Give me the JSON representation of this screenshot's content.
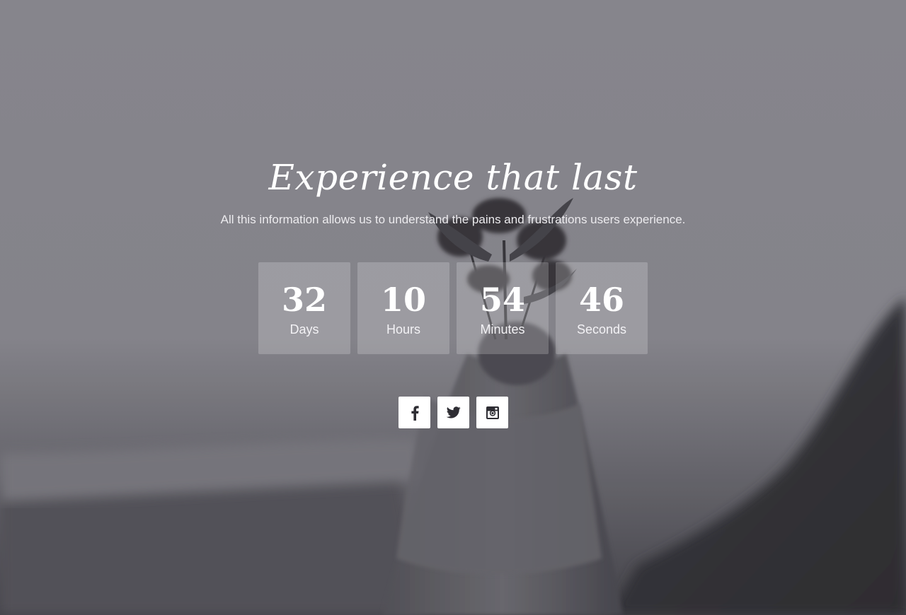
{
  "hero": {
    "title": "Experience that last",
    "subtitle": "All this information allows us to understand the pains and frustrations users experience."
  },
  "countdown": [
    {
      "value": "32",
      "label": "Days"
    },
    {
      "value": "10",
      "label": "Hours"
    },
    {
      "value": "54",
      "label": "Minutes"
    },
    {
      "value": "46",
      "label": "Seconds"
    }
  ],
  "social": [
    {
      "icon": "facebook-icon"
    },
    {
      "icon": "twitter-icon"
    },
    {
      "icon": "instagram-icon"
    }
  ],
  "colors": {
    "overlay": "#8a8990",
    "icon_dark": "#2e2d33",
    "text": "#ffffff"
  }
}
